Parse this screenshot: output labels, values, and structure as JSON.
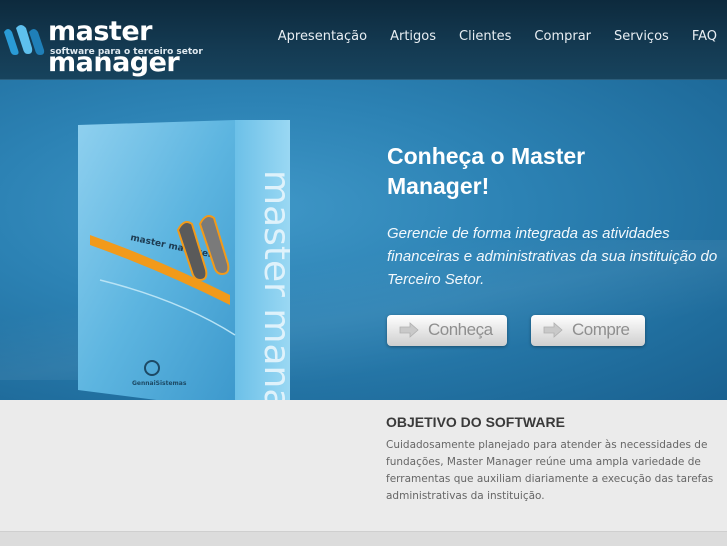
{
  "header": {
    "logo_title": "master manager",
    "logo_subtitle": "software para o terceiro setor",
    "nav": [
      {
        "label": "Apresentação"
      },
      {
        "label": "Artigos"
      },
      {
        "label": "Clientes"
      },
      {
        "label": "Comprar"
      },
      {
        "label": "Serviços"
      },
      {
        "label": "FAQ"
      }
    ]
  },
  "hero": {
    "title": "Conheça o Master Manager!",
    "description": "Gerencie de forma integrada as atividades financeiras e administrativas da sua instituição do Terceiro Setor.",
    "buttons": {
      "primary": "Conheça",
      "secondary": "Compre"
    },
    "product_box": {
      "spine_text": "master manager",
      "front_text": "master manager",
      "brand": "GennaiSistemas"
    }
  },
  "objective": {
    "title": "OBJETIVO DO SOFTWARE",
    "text": "Cuidadosamente planejado para atender às necessidades de fundações, Master Manager reúne uma ampla variedade de ferramentas que auxiliam diariamente a execução das tarefas administrativas da instituição."
  },
  "colors": {
    "header_bg": "#143a52",
    "hero_bg": "#2c82b4",
    "button_text": "#8f8f8f"
  }
}
